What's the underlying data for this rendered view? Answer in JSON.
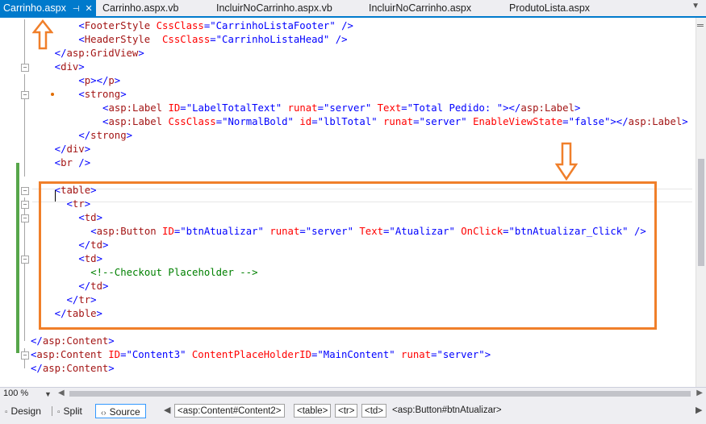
{
  "tabs": [
    {
      "label": "Carrinho.aspx",
      "active": true
    },
    {
      "label": "Carrinho.aspx.vb"
    },
    {
      "label": "IncluirNoCarrinho.aspx.vb"
    },
    {
      "label": "IncluirNoCarrinho.aspx"
    },
    {
      "label": "ProdutoLista.aspx"
    }
  ],
  "colors": {
    "tag": "#a31515",
    "attribute": "#ff0000",
    "value": "#0000ff",
    "comment": "#008000",
    "annotation": "#f07f2a",
    "active_tab": "#007acc",
    "change_bar": "#57a64a"
  },
  "icons": [
    "pin-icon",
    "close-icon",
    "dropdown-icon",
    "split-window-icon",
    "design-view-icon",
    "split-view-icon",
    "source-view-icon",
    "arrow-up-annotation",
    "arrow-down-annotation"
  ],
  "code_lines": [
    {
      "indent": "        ",
      "segments": [
        {
          "k": "d",
          "s": "<"
        },
        {
          "k": "t",
          "s": "FooterStyle"
        },
        {
          "k": "p",
          "s": " "
        },
        {
          "k": "a",
          "s": "CssClass"
        },
        {
          "k": "v",
          "s": "=\"CarrinhoListaFooter\""
        },
        {
          "k": "p",
          "s": " "
        },
        {
          "k": "d",
          "s": "/>"
        }
      ]
    },
    {
      "indent": "        ",
      "segments": [
        {
          "k": "d",
          "s": "<"
        },
        {
          "k": "t",
          "s": "HeaderStyle"
        },
        {
          "k": "p",
          "s": "  "
        },
        {
          "k": "a",
          "s": "CssClass"
        },
        {
          "k": "v",
          "s": "=\"CarrinhoListaHead\""
        },
        {
          "k": "p",
          "s": " "
        },
        {
          "k": "d",
          "s": "/>"
        }
      ]
    },
    {
      "indent": "    ",
      "segments": [
        {
          "k": "d",
          "s": "</"
        },
        {
          "k": "t",
          "s": "asp:GridView"
        },
        {
          "k": "d",
          "s": ">"
        }
      ]
    },
    {
      "indent": "    ",
      "segments": [
        {
          "k": "d",
          "s": "<"
        },
        {
          "k": "t",
          "s": "div"
        },
        {
          "k": "d",
          "s": ">"
        }
      ]
    },
    {
      "indent": "        ",
      "segments": [
        {
          "k": "d",
          "s": "<"
        },
        {
          "k": "t",
          "s": "p"
        },
        {
          "k": "d",
          "s": "></"
        },
        {
          "k": "t",
          "s": "p"
        },
        {
          "k": "d",
          "s": ">"
        }
      ]
    },
    {
      "indent": "        ",
      "segments": [
        {
          "k": "d",
          "s": "<"
        },
        {
          "k": "t",
          "s": "strong"
        },
        {
          "k": "d",
          "s": ">"
        }
      ]
    },
    {
      "indent": "            ",
      "segments": [
        {
          "k": "d",
          "s": "<"
        },
        {
          "k": "t",
          "s": "asp:Label"
        },
        {
          "k": "p",
          "s": " "
        },
        {
          "k": "a",
          "s": "ID"
        },
        {
          "k": "v",
          "s": "=\"LabelTotalText\""
        },
        {
          "k": "p",
          "s": " "
        },
        {
          "k": "a",
          "s": "runat"
        },
        {
          "k": "v",
          "s": "=\"server\""
        },
        {
          "k": "p",
          "s": " "
        },
        {
          "k": "a",
          "s": "Text"
        },
        {
          "k": "v",
          "s": "=\"Total Pedido: \""
        },
        {
          "k": "d",
          "s": "></"
        },
        {
          "k": "t",
          "s": "asp:Label"
        },
        {
          "k": "d",
          "s": ">"
        }
      ]
    },
    {
      "indent": "            ",
      "segments": [
        {
          "k": "d",
          "s": "<"
        },
        {
          "k": "t",
          "s": "asp:Label"
        },
        {
          "k": "p",
          "s": " "
        },
        {
          "k": "a",
          "s": "CssClass"
        },
        {
          "k": "v",
          "s": "=\"NormalBold\""
        },
        {
          "k": "p",
          "s": " "
        },
        {
          "k": "a",
          "s": "id"
        },
        {
          "k": "v",
          "s": "=\"lblTotal\""
        },
        {
          "k": "p",
          "s": " "
        },
        {
          "k": "a",
          "s": "runat"
        },
        {
          "k": "v",
          "s": "=\"server\""
        },
        {
          "k": "p",
          "s": " "
        },
        {
          "k": "a",
          "s": "EnableViewState"
        },
        {
          "k": "v",
          "s": "=\"false\""
        },
        {
          "k": "d",
          "s": "></"
        },
        {
          "k": "t",
          "s": "asp:Label"
        },
        {
          "k": "d",
          "s": ">"
        }
      ]
    },
    {
      "indent": "        ",
      "segments": [
        {
          "k": "d",
          "s": "</"
        },
        {
          "k": "t",
          "s": "strong"
        },
        {
          "k": "d",
          "s": ">"
        }
      ]
    },
    {
      "indent": "    ",
      "segments": [
        {
          "k": "d",
          "s": "</"
        },
        {
          "k": "t",
          "s": "div"
        },
        {
          "k": "d",
          "s": ">"
        }
      ]
    },
    {
      "indent": "    ",
      "segments": [
        {
          "k": "d",
          "s": "<"
        },
        {
          "k": "t",
          "s": "br"
        },
        {
          "k": "p",
          "s": " "
        },
        {
          "k": "d",
          "s": "/>"
        }
      ]
    },
    {
      "indent": "",
      "segments": []
    },
    {
      "indent": "    ",
      "segments": [
        {
          "k": "d",
          "s": "<"
        },
        {
          "k": "t",
          "s": "table"
        },
        {
          "k": "d",
          "s": ">"
        }
      ]
    },
    {
      "indent": "      ",
      "segments": [
        {
          "k": "d",
          "s": "<"
        },
        {
          "k": "t",
          "s": "tr"
        },
        {
          "k": "d",
          "s": ">"
        }
      ]
    },
    {
      "indent": "        ",
      "segments": [
        {
          "k": "d",
          "s": "<"
        },
        {
          "k": "t",
          "s": "td"
        },
        {
          "k": "d",
          "s": ">"
        }
      ]
    },
    {
      "indent": "          ",
      "segments": [
        {
          "k": "d",
          "s": "<"
        },
        {
          "k": "t",
          "s": "asp:Button"
        },
        {
          "k": "p",
          "s": " "
        },
        {
          "k": "a",
          "s": "ID"
        },
        {
          "k": "v",
          "s": "=\"btnAtualizar\""
        },
        {
          "k": "p",
          "s": " "
        },
        {
          "k": "a",
          "s": "runat"
        },
        {
          "k": "v",
          "s": "=\"server\""
        },
        {
          "k": "p",
          "s": " "
        },
        {
          "k": "a",
          "s": "Text"
        },
        {
          "k": "v",
          "s": "=\"Atualizar\""
        },
        {
          "k": "p",
          "s": " "
        },
        {
          "k": "a",
          "s": "OnClick"
        },
        {
          "k": "v",
          "s": "=\"btnAtualizar_Click\""
        },
        {
          "k": "p",
          "s": " "
        },
        {
          "k": "d",
          "s": "/>"
        }
      ]
    },
    {
      "indent": "        ",
      "segments": [
        {
          "k": "d",
          "s": "</"
        },
        {
          "k": "t",
          "s": "td"
        },
        {
          "k": "d",
          "s": ">"
        }
      ]
    },
    {
      "indent": "        ",
      "segments": [
        {
          "k": "d",
          "s": "<"
        },
        {
          "k": "t",
          "s": "td"
        },
        {
          "k": "d",
          "s": ">"
        }
      ]
    },
    {
      "indent": "          ",
      "segments": [
        {
          "k": "c",
          "s": "<!--Checkout Placeholder -->"
        }
      ]
    },
    {
      "indent": "        ",
      "segments": [
        {
          "k": "d",
          "s": "</"
        },
        {
          "k": "t",
          "s": "td"
        },
        {
          "k": "d",
          "s": ">"
        }
      ]
    },
    {
      "indent": "      ",
      "segments": [
        {
          "k": "d",
          "s": "</"
        },
        {
          "k": "t",
          "s": "tr"
        },
        {
          "k": "d",
          "s": ">"
        }
      ]
    },
    {
      "indent": "    ",
      "segments": [
        {
          "k": "d",
          "s": "</"
        },
        {
          "k": "t",
          "s": "table"
        },
        {
          "k": "d",
          "s": ">"
        }
      ]
    },
    {
      "indent": "",
      "segments": []
    },
    {
      "indent": "",
      "segments": [
        {
          "k": "d",
          "s": "</"
        },
        {
          "k": "t",
          "s": "asp:Content"
        },
        {
          "k": "d",
          "s": ">"
        }
      ]
    },
    {
      "indent": "",
      "segments": [
        {
          "k": "d",
          "s": "<"
        },
        {
          "k": "t",
          "s": "asp:Content"
        },
        {
          "k": "p",
          "s": " "
        },
        {
          "k": "a",
          "s": "ID"
        },
        {
          "k": "v",
          "s": "=\"Content3\""
        },
        {
          "k": "p",
          "s": " "
        },
        {
          "k": "a",
          "s": "ContentPlaceHolderID"
        },
        {
          "k": "v",
          "s": "=\"MainContent\""
        },
        {
          "k": "p",
          "s": " "
        },
        {
          "k": "a",
          "s": "runat"
        },
        {
          "k": "v",
          "s": "=\"server\""
        },
        {
          "k": "d",
          "s": ">"
        }
      ]
    },
    {
      "indent": "",
      "segments": [
        {
          "k": "d",
          "s": "</"
        },
        {
          "k": "t",
          "s": "asp:Content"
        },
        {
          "k": "d",
          "s": ">"
        }
      ]
    }
  ],
  "zoom": "100 %",
  "views": {
    "design": "Design",
    "split": "Split",
    "source": "Source",
    "selected": "Source"
  },
  "breadcrumb": [
    "<asp:Content#Content2>",
    "<table>",
    "<tr>",
    "<td>",
    "<asp:Button#btnAtualizar>"
  ]
}
